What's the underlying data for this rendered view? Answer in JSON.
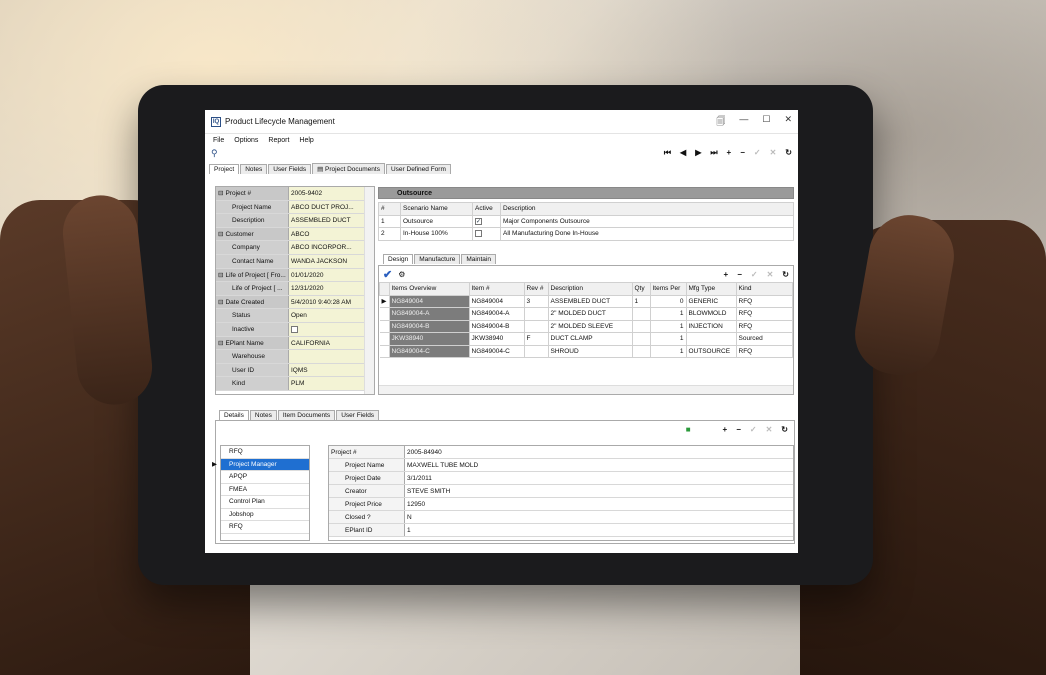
{
  "window": {
    "title": "Product Lifecycle Management",
    "logo": "IQ",
    "controls": [
      "🗐",
      "—",
      "☐",
      "✕"
    ]
  },
  "menu": [
    "File",
    "Options",
    "Report",
    "Help"
  ],
  "top_tabs": [
    "Project",
    "Notes",
    "User Fields",
    "Project Documents",
    "User Defined Form"
  ],
  "nav_buttons": [
    "⏮",
    "◀",
    "▶",
    "⏭",
    "+",
    "−",
    "✓",
    "✕",
    "↻"
  ],
  "project_props": [
    {
      "label": "Project #",
      "value": "2005-9402",
      "group": true
    },
    {
      "label": "Project Name",
      "value": "ABCO DUCT PROJ...",
      "child": true
    },
    {
      "label": "Description",
      "value": "ASSEMBLED DUCT",
      "child": true
    },
    {
      "label": "Customer",
      "value": "ABCO",
      "group": true
    },
    {
      "label": "Company",
      "value": "ABCO INCORPOR...",
      "child": true
    },
    {
      "label": "Contact Name",
      "value": "WANDA JACKSON",
      "child": true
    },
    {
      "label": "Life of Project [ Fro...",
      "value": "01/01/2020",
      "group": true
    },
    {
      "label": "Life of Project [ ...",
      "value": "12/31/2020",
      "child": true
    },
    {
      "label": "Date Created",
      "value": "5/4/2010 9:40:28 AM",
      "group": true
    },
    {
      "label": "Status",
      "value": "Open",
      "child": true
    },
    {
      "label": "Inactive",
      "value": "",
      "child": true,
      "checkbox": true
    },
    {
      "label": "EPlant Name",
      "value": "CALIFORNIA",
      "group": true
    },
    {
      "label": "Warehouse",
      "value": "",
      "child": true
    },
    {
      "label": "User ID",
      "value": "IQMS",
      "child": true
    },
    {
      "label": "Kind",
      "value": "PLM",
      "child": true
    }
  ],
  "outsource": {
    "header": "Outsource",
    "columns": [
      "#",
      "Scenario Name",
      "Active",
      "Description"
    ],
    "rows": [
      {
        "num": "1",
        "name": "Outsource",
        "active": true,
        "desc": "Major Components Outsource"
      },
      {
        "num": "2",
        "name": "In-House 100%",
        "active": false,
        "desc": "All Manufacturing Done In-House"
      }
    ]
  },
  "design_tabs": [
    "Design",
    "Manufacture",
    "Maintain"
  ],
  "design_grid": {
    "columns": [
      "Items Overview",
      "Item #",
      "Rev #",
      "Description",
      "Qty",
      "Items Per",
      "Mfg Type",
      "Kind"
    ],
    "rows": [
      {
        "overview": "NG849004",
        "item": "NG849004",
        "rev": "3",
        "desc": "ASSEMBLED DUCT",
        "qty": "1",
        "per": "0",
        "mfg": "GENERIC",
        "kind": "RFQ"
      },
      {
        "overview": "NG849004-A",
        "item": "NG849004-A",
        "rev": "",
        "desc": "2\" MOLDED DUCT",
        "qty": "",
        "per": "1",
        "mfg": "BLOWMOLD",
        "kind": "RFQ"
      },
      {
        "overview": "NG849004-B",
        "item": "NG849004-B",
        "rev": "",
        "desc": "2\" MOLDED SLEEVE",
        "qty": "",
        "per": "1",
        "mfg": "INJECTION",
        "kind": "RFQ"
      },
      {
        "overview": "JKW38940",
        "item": "JKW38940",
        "rev": "F",
        "desc": "DUCT CLAMP",
        "qty": "",
        "per": "1",
        "mfg": "",
        "kind": "Sourced"
      },
      {
        "overview": "NG849004-C",
        "item": "NG849004-C",
        "rev": "",
        "desc": "SHROUD",
        "qty": "",
        "per": "1",
        "mfg": "OUTSOURCE",
        "kind": "RFQ"
      }
    ]
  },
  "bottom_tabs": [
    "Details",
    "Notes",
    "Item Documents",
    "User Fields"
  ],
  "stage_list": [
    "RFQ",
    "Project Manager",
    "APQP",
    "FMEA",
    "Control Plan",
    "Jobshop",
    "RFQ"
  ],
  "stage_selected": 1,
  "detail_props": [
    {
      "label": "Project #",
      "value": "2005-84940",
      "group": true
    },
    {
      "label": "Project Name",
      "value": "MAXWELL TUBE MOLD",
      "child": true
    },
    {
      "label": "Project Date",
      "value": "3/1/2011",
      "child": true
    },
    {
      "label": "Creator",
      "value": "STEVE SMITH",
      "child": true
    },
    {
      "label": "Project Price",
      "value": "12950",
      "child": true
    },
    {
      "label": "Closed ?",
      "value": "N",
      "child": true
    },
    {
      "label": "EPlant ID",
      "value": "1",
      "child": true
    }
  ]
}
